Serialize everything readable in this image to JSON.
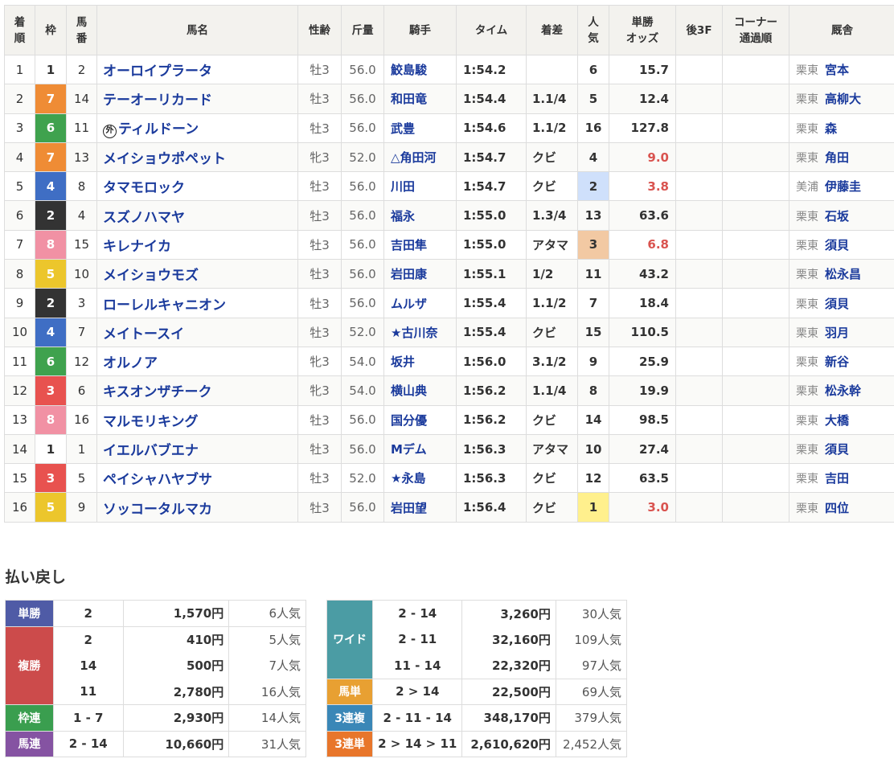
{
  "headers": [
    "着順",
    "枠",
    "馬番",
    "馬名",
    "性齢",
    "斤量",
    "騎手",
    "タイム",
    "着差",
    "人気",
    "単勝オッズ",
    "後3F",
    "コーナー通過順",
    "厩舎"
  ],
  "header_lines": [
    [
      "着",
      "順"
    ],
    [
      "枠"
    ],
    [
      "馬",
      "番"
    ],
    [
      "馬名"
    ],
    [
      "性齢"
    ],
    [
      "斤量"
    ],
    [
      "騎手"
    ],
    [
      "タイム"
    ],
    [
      "着差"
    ],
    [
      "人",
      "気"
    ],
    [
      "単勝",
      "オッズ"
    ],
    [
      "後3F"
    ],
    [
      "コーナー",
      "通過順"
    ],
    [
      "厩舎"
    ]
  ],
  "waku_colors": {
    "1": {
      "bg": "#ffffff",
      "fg": "#333333"
    },
    "2": {
      "bg": "#333333",
      "fg": "#ffffff"
    },
    "3": {
      "bg": "#e8524f",
      "fg": "#ffffff"
    },
    "4": {
      "bg": "#3f6ec4",
      "fg": "#ffffff"
    },
    "5": {
      "bg": "#ecc62c",
      "fg": "#ffffff"
    },
    "6": {
      "bg": "#3fa24e",
      "fg": "#ffffff"
    },
    "7": {
      "bg": "#ef8c35",
      "fg": "#ffffff"
    },
    "8": {
      "bg": "#f191a4",
      "fg": "#ffffff"
    }
  },
  "foreign_mark": "外",
  "rows": [
    {
      "rank": "1",
      "waku": "1",
      "num": "2",
      "name": "オーロイプラータ",
      "foreign": false,
      "sex": "牡3",
      "weight": "56.0",
      "jockey": "鮫島駿",
      "time": "1:54.2",
      "margin": "",
      "pop": "6",
      "odds": "15.7",
      "last3f": "",
      "corner": "",
      "loc": "栗東",
      "trainer": "宮本"
    },
    {
      "rank": "2",
      "waku": "7",
      "num": "14",
      "name": "テーオーリカード",
      "foreign": false,
      "sex": "牡3",
      "weight": "56.0",
      "jockey": "和田竜",
      "time": "1:54.4",
      "margin": "1.1/4",
      "pop": "5",
      "odds": "12.4",
      "last3f": "",
      "corner": "",
      "loc": "栗東",
      "trainer": "高柳大"
    },
    {
      "rank": "3",
      "waku": "6",
      "num": "11",
      "name": "ティルドーン",
      "foreign": true,
      "sex": "牡3",
      "weight": "56.0",
      "jockey": "武豊",
      "time": "1:54.6",
      "margin": "1.1/2",
      "pop": "16",
      "odds": "127.8",
      "last3f": "",
      "corner": "",
      "loc": "栗東",
      "trainer": "森"
    },
    {
      "rank": "4",
      "waku": "7",
      "num": "13",
      "name": "メイショウポペット",
      "foreign": false,
      "sex": "牝3",
      "weight": "52.0",
      "jockey": "△角田河",
      "time": "1:54.7",
      "margin": "クビ",
      "pop": "4",
      "odds": "9.0",
      "last3f": "",
      "corner": "",
      "loc": "栗東",
      "trainer": "角田"
    },
    {
      "rank": "5",
      "waku": "4",
      "num": "8",
      "name": "タマモロック",
      "foreign": false,
      "sex": "牡3",
      "weight": "56.0",
      "jockey": "川田",
      "time": "1:54.7",
      "margin": "クビ",
      "pop": "2",
      "odds": "3.8",
      "last3f": "",
      "corner": "",
      "loc": "美浦",
      "trainer": "伊藤圭"
    },
    {
      "rank": "6",
      "waku": "2",
      "num": "4",
      "name": "スズノハマヤ",
      "foreign": false,
      "sex": "牡3",
      "weight": "56.0",
      "jockey": "福永",
      "time": "1:55.0",
      "margin": "1.3/4",
      "pop": "13",
      "odds": "63.6",
      "last3f": "",
      "corner": "",
      "loc": "栗東",
      "trainer": "石坂"
    },
    {
      "rank": "7",
      "waku": "8",
      "num": "15",
      "name": "キレナイカ",
      "foreign": false,
      "sex": "牡3",
      "weight": "56.0",
      "jockey": "吉田隼",
      "time": "1:55.0",
      "margin": "アタマ",
      "pop": "3",
      "odds": "6.8",
      "last3f": "",
      "corner": "",
      "loc": "栗東",
      "trainer": "須貝"
    },
    {
      "rank": "8",
      "waku": "5",
      "num": "10",
      "name": "メイショウモズ",
      "foreign": false,
      "sex": "牡3",
      "weight": "56.0",
      "jockey": "岩田康",
      "time": "1:55.1",
      "margin": "1/2",
      "pop": "11",
      "odds": "43.2",
      "last3f": "",
      "corner": "",
      "loc": "栗東",
      "trainer": "松永昌"
    },
    {
      "rank": "9",
      "waku": "2",
      "num": "3",
      "name": "ローレルキャニオン",
      "foreign": false,
      "sex": "牡3",
      "weight": "56.0",
      "jockey": "ムルザ",
      "time": "1:55.4",
      "margin": "1.1/2",
      "pop": "7",
      "odds": "18.4",
      "last3f": "",
      "corner": "",
      "loc": "栗東",
      "trainer": "須貝"
    },
    {
      "rank": "10",
      "waku": "4",
      "num": "7",
      "name": "メイトースイ",
      "foreign": false,
      "sex": "牡3",
      "weight": "52.0",
      "jockey": "★古川奈",
      "time": "1:55.4",
      "margin": "クビ",
      "pop": "15",
      "odds": "110.5",
      "last3f": "",
      "corner": "",
      "loc": "栗東",
      "trainer": "羽月"
    },
    {
      "rank": "11",
      "waku": "6",
      "num": "12",
      "name": "オルノア",
      "foreign": false,
      "sex": "牝3",
      "weight": "54.0",
      "jockey": "坂井",
      "time": "1:56.0",
      "margin": "3.1/2",
      "pop": "9",
      "odds": "25.9",
      "last3f": "",
      "corner": "",
      "loc": "栗東",
      "trainer": "新谷"
    },
    {
      "rank": "12",
      "waku": "3",
      "num": "6",
      "name": "キスオンザチーク",
      "foreign": false,
      "sex": "牝3",
      "weight": "54.0",
      "jockey": "横山典",
      "time": "1:56.2",
      "margin": "1.1/4",
      "pop": "8",
      "odds": "19.9",
      "last3f": "",
      "corner": "",
      "loc": "栗東",
      "trainer": "松永幹"
    },
    {
      "rank": "13",
      "waku": "8",
      "num": "16",
      "name": "マルモリキング",
      "foreign": false,
      "sex": "牡3",
      "weight": "56.0",
      "jockey": "国分優",
      "time": "1:56.2",
      "margin": "クビ",
      "pop": "14",
      "odds": "98.5",
      "last3f": "",
      "corner": "",
      "loc": "栗東",
      "trainer": "大橋"
    },
    {
      "rank": "14",
      "waku": "1",
      "num": "1",
      "name": "イエルバブエナ",
      "foreign": false,
      "sex": "牡3",
      "weight": "56.0",
      "jockey": "Mデム",
      "time": "1:56.3",
      "margin": "アタマ",
      "pop": "10",
      "odds": "27.4",
      "last3f": "",
      "corner": "",
      "loc": "栗東",
      "trainer": "須貝"
    },
    {
      "rank": "15",
      "waku": "3",
      "num": "5",
      "name": "ペイシャハヤブサ",
      "foreign": false,
      "sex": "牡3",
      "weight": "52.0",
      "jockey": "★永島",
      "time": "1:56.3",
      "margin": "クビ",
      "pop": "12",
      "odds": "63.5",
      "last3f": "",
      "corner": "",
      "loc": "栗東",
      "trainer": "吉田"
    },
    {
      "rank": "16",
      "waku": "5",
      "num": "9",
      "name": "ソッコータルマカ",
      "foreign": false,
      "sex": "牡3",
      "weight": "56.0",
      "jockey": "岩田望",
      "time": "1:56.4",
      "margin": "クビ",
      "pop": "1",
      "odds": "3.0",
      "last3f": "",
      "corner": "",
      "loc": "栗東",
      "trainer": "四位"
    }
  ],
  "payout": {
    "heading": "払い戻し",
    "left": [
      {
        "type": "単勝",
        "color": "#4f5ba6",
        "entries": [
          {
            "combo": "2",
            "amount": "1,570円",
            "pop": "6人気"
          }
        ]
      },
      {
        "type": "複勝",
        "color": "#cc4b4b",
        "entries": [
          {
            "combo": "2",
            "amount": "410円",
            "pop": "5人気"
          },
          {
            "combo": "14",
            "amount": "500円",
            "pop": "7人気"
          },
          {
            "combo": "11",
            "amount": "2,780円",
            "pop": "16人気"
          }
        ]
      },
      {
        "type": "枠連",
        "color": "#3a9e4f",
        "entries": [
          {
            "combo": "1 - 7",
            "amount": "2,930円",
            "pop": "14人気"
          }
        ]
      },
      {
        "type": "馬連",
        "color": "#8553a2",
        "entries": [
          {
            "combo": "2 - 14",
            "amount": "10,660円",
            "pop": "31人気"
          }
        ]
      }
    ],
    "right": [
      {
        "type": "ワイド",
        "color": "#4b9ca4",
        "entries": [
          {
            "combo": "2 - 14",
            "amount": "3,260円",
            "pop": "30人気"
          },
          {
            "combo": "2 - 11",
            "amount": "32,160円",
            "pop": "109人気"
          },
          {
            "combo": "11 - 14",
            "amount": "22,320円",
            "pop": "97人気"
          }
        ]
      },
      {
        "type": "馬単",
        "color": "#e8a032",
        "entries": [
          {
            "combo": "2 > 14",
            "amount": "22,500円",
            "pop": "69人気"
          }
        ]
      },
      {
        "type": "3連複",
        "color": "#3a87b7",
        "entries": [
          {
            "combo": "2 - 11 - 14",
            "amount": "348,170円",
            "pop": "379人気"
          }
        ]
      },
      {
        "type": "3連単",
        "color": "#e8762b",
        "entries": [
          {
            "combo": "2 > 14 > 11",
            "amount": "2,610,620円",
            "pop": "2,452人気"
          }
        ]
      }
    ]
  }
}
